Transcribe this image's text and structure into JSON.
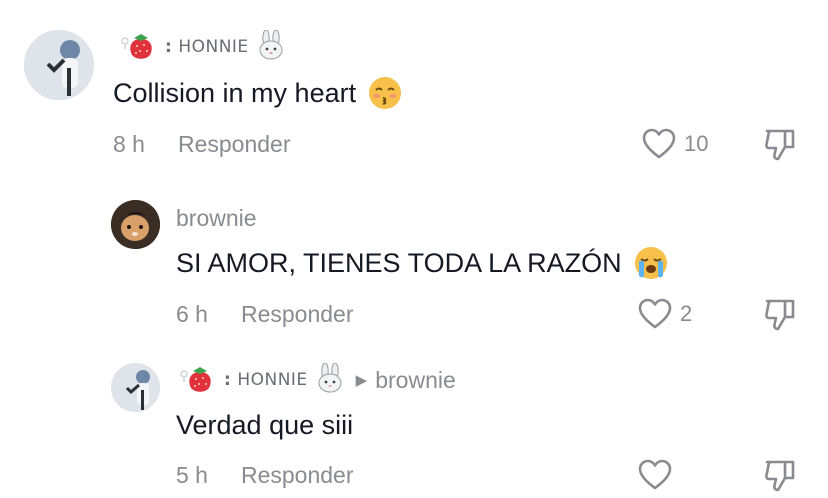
{
  "comments": [
    {
      "user": "HONNIE",
      "text": "Collision in my heart",
      "text_emoji": "kissing-closed-eyes-emoji",
      "time": "8 h",
      "reply_label": "Responder",
      "likes": "10"
    },
    {
      "user": "brownie",
      "text": "SI AMOR, TIENES TODA LA RAZÓN",
      "text_emoji": "loudly-crying-emoji",
      "time": "6 h",
      "reply_label": "Responder",
      "likes": "2"
    },
    {
      "user": "HONNIE",
      "reply_to": "brownie",
      "text": "Verdad que siii",
      "time": "5 h",
      "reply_label": "Responder",
      "likes": ""
    }
  ],
  "username_prefix": ":",
  "colors": {
    "text": "#161823",
    "muted": "#8a8b91",
    "emoji_yellow": "#f7c04a",
    "strawberry": "#e0323e"
  }
}
